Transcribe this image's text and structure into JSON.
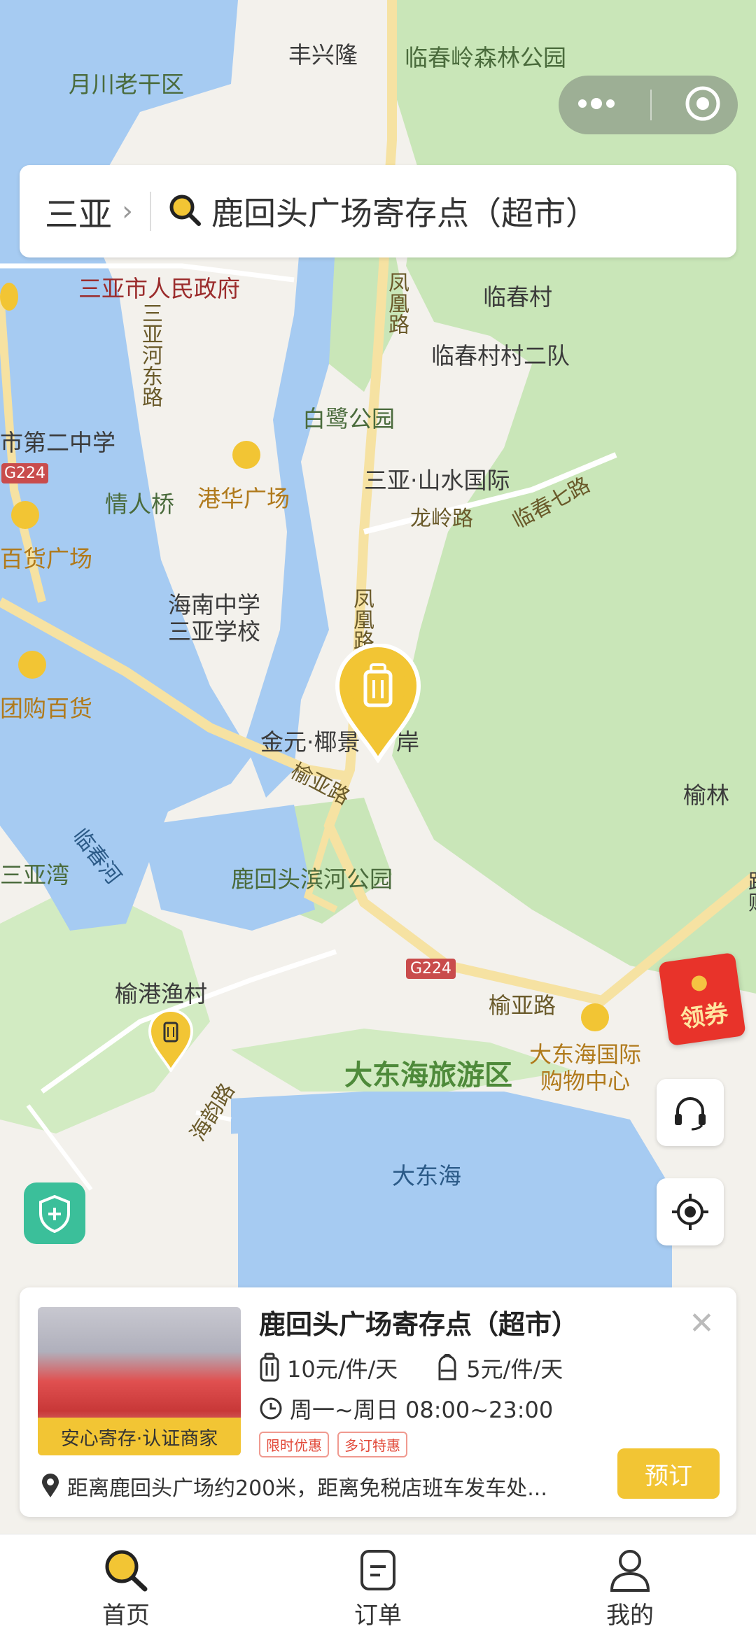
{
  "search": {
    "city": "三亚",
    "query": "鹿回头广场寄存点（超市）"
  },
  "map": {
    "labels": {
      "fengxinglong": "丰兴隆",
      "linchunling_park": "临春岭森林公园",
      "yuechuan": "月川老干区",
      "sanya_gov": "三亚市人民政府",
      "sanyahe_east_rd": "三亚河东路",
      "fenghuang_rd_1": "凤凰路",
      "linchun_village": "临春村",
      "linchun_team2": "临春村村二队",
      "bailu_park": "白鹭公园",
      "shanshui": "三亚·山水国际",
      "longling_rd": "龙岭路",
      "linchun7_rd": "临春七路",
      "no2_middle": "市第二中学",
      "g224_a": "G224",
      "qingren_bridge": "情人桥",
      "ganghua": "港华广场",
      "baihuo": "百货广场",
      "hainan_middle": "海南中学\n三亚学校",
      "fenghuang_rd_2": "凤凰路",
      "tuangou": "团购百货",
      "jinyuan": "金元·椰景",
      "jinyuan_b": "岸",
      "yuya_rd_1": "榆亚路",
      "yulin": "榆林",
      "sanyawan": "三亚湾",
      "linchunhe": "临春河",
      "luhuitou_park": "鹿回头滨河公园",
      "g224_b": "G224",
      "yuya_rd_2": "榆亚路",
      "yugang": "榆港渔村",
      "dadonghai_area": "大东海旅游区",
      "dadonghai_mall": "大东海国际\n购物中心",
      "haiyun_rd": "海韵路",
      "dadonghai": "大东海",
      "edge_road": "路购"
    }
  },
  "capsule": {
    "more_icon": "more-dots-icon",
    "close_icon": "target-close-icon"
  },
  "coupon": {
    "label": "领券"
  },
  "card": {
    "title": "鹿回头广场寄存点（超市）",
    "thumb_tag": "安心寄存·认证商家",
    "price_large": "10元/件/天",
    "price_small": "5元/件/天",
    "hours": "周一~周日 08:00~23:00",
    "badges": [
      "限时优惠",
      "多订特惠"
    ],
    "address": "距离鹿回头广场约200米，距离免税店班车发车处...",
    "book_label": "预订"
  },
  "tabs": [
    {
      "label": "首页",
      "icon": "search-icon"
    },
    {
      "label": "订单",
      "icon": "order-icon"
    },
    {
      "label": "我的",
      "icon": "user-icon"
    }
  ],
  "colors": {
    "accent": "#f2c534",
    "water": "#a6cbf2",
    "green": "#c9e6b8",
    "road": "#f6e2a2"
  }
}
